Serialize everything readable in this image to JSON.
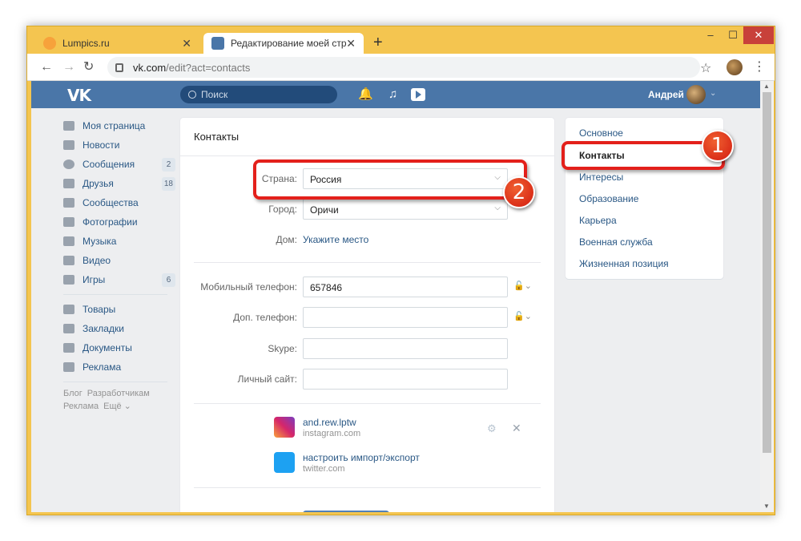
{
  "browser": {
    "tabs": [
      {
        "title": "Lumpics.ru",
        "close": "✕"
      },
      {
        "title": "Редактирование моей страниц",
        "close": "✕"
      }
    ],
    "new_tab": "+",
    "window_controls": {
      "minimize": "‒",
      "maximize": "☐",
      "close": "✕"
    },
    "url_host": "vk.com",
    "url_path": "/edit?act=contacts"
  },
  "vk": {
    "logo": "VK",
    "search_placeholder": "Поиск",
    "user_name": "Андрей"
  },
  "left_nav": {
    "items": [
      {
        "label": "Моя страница",
        "badge": ""
      },
      {
        "label": "Новости",
        "badge": ""
      },
      {
        "label": "Сообщения",
        "badge": "2"
      },
      {
        "label": "Друзья",
        "badge": "18"
      },
      {
        "label": "Сообщества",
        "badge": ""
      },
      {
        "label": "Фотографии",
        "badge": ""
      },
      {
        "label": "Музыка",
        "badge": ""
      },
      {
        "label": "Видео",
        "badge": ""
      },
      {
        "label": "Игры",
        "badge": "6"
      },
      {
        "label": "Товары",
        "badge": ""
      },
      {
        "label": "Закладки",
        "badge": ""
      },
      {
        "label": "Документы",
        "badge": ""
      },
      {
        "label": "Реклама",
        "badge": ""
      }
    ],
    "footer": [
      "Блог",
      "Разработчикам",
      "Реклама",
      "Ещё ⌄"
    ]
  },
  "contacts": {
    "title": "Контакты",
    "country_label": "Страна:",
    "country_value": "Россия",
    "city_label": "Город:",
    "city_value": "Оричи",
    "home_label": "Дом:",
    "home_link": "Укажите место",
    "mobile_label": "Мобильный телефон:",
    "mobile_value": "657846",
    "extra_phone_label": "Доп. телефон:",
    "extra_phone_value": "",
    "skype_label": "Skype:",
    "skype_value": "",
    "site_label": "Личный сайт:",
    "site_value": "",
    "services": [
      {
        "name": "and.rew.lptw",
        "sub": "instagram.com",
        "color": "#c13584"
      },
      {
        "name": "настроить импорт/экспорт",
        "sub": "twitter.com",
        "color": "#1da1f2"
      }
    ]
  },
  "right_menu": {
    "items": [
      "Основное",
      "Контакты",
      "Интересы",
      "Образование",
      "Карьера",
      "Военная служба",
      "Жизненная позиция"
    ],
    "selected": "Контакты"
  },
  "annotations": {
    "step1": "1",
    "step2": "2",
    "highlight_color": "#e3201b"
  }
}
